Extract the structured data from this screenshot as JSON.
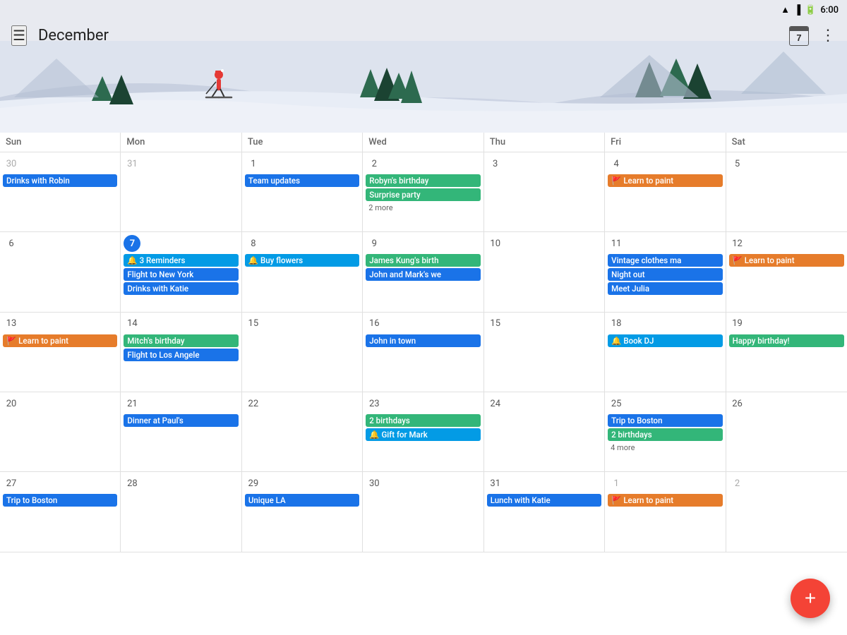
{
  "statusBar": {
    "time": "6:00"
  },
  "header": {
    "menuLabel": "☰",
    "month": "December",
    "calDay": "7",
    "moreLabel": "⋮"
  },
  "dayHeaders": [
    "Sun",
    "Mon",
    "Tue",
    "Wed",
    "Thu",
    "Fri",
    "Sat"
  ],
  "weeks": [
    [
      {
        "num": "30",
        "otherMonth": true,
        "events": [
          {
            "label": "Drinks with Robin",
            "color": "blue"
          }
        ]
      },
      {
        "num": "31",
        "otherMonth": true,
        "events": []
      },
      {
        "num": "1",
        "events": [
          {
            "label": "Team updates",
            "color": "blue"
          }
        ]
      },
      {
        "num": "2",
        "events": [
          {
            "label": "Robyn's birthday",
            "color": "green"
          },
          {
            "label": "Surprise party",
            "color": "green"
          }
        ],
        "more": "2 more"
      },
      {
        "num": "3",
        "events": []
      },
      {
        "num": "4",
        "events": [
          {
            "label": "🚩 Learn to paint",
            "color": "orange"
          }
        ]
      },
      {
        "num": "5",
        "events": []
      }
    ],
    [
      {
        "num": "6",
        "events": []
      },
      {
        "num": "7",
        "today": true,
        "events": [
          {
            "label": "🔔 3 Reminders",
            "color": "cyan"
          },
          {
            "label": "Flight to New York",
            "color": "blue"
          },
          {
            "label": "Drinks with Katie",
            "color": "blue"
          }
        ]
      },
      {
        "num": "8",
        "events": [
          {
            "label": "🔔 Buy flowers",
            "color": "cyan"
          }
        ]
      },
      {
        "num": "9",
        "events": [
          {
            "label": "James Kung's birth",
            "color": "green"
          },
          {
            "label": "John and Mark's we",
            "color": "blue"
          }
        ]
      },
      {
        "num": "10",
        "events": []
      },
      {
        "num": "11",
        "events": [
          {
            "label": "Vintage clothes ma",
            "color": "blue"
          },
          {
            "label": "Night out",
            "color": "blue"
          },
          {
            "label": "Meet Julia",
            "color": "blue"
          }
        ]
      },
      {
        "num": "12",
        "events": [
          {
            "label": "🚩 Learn to paint",
            "color": "orange"
          }
        ]
      }
    ],
    [
      {
        "num": "13",
        "events": [
          {
            "label": "🚩 Learn to paint",
            "color": "orange"
          }
        ]
      },
      {
        "num": "14",
        "events": [
          {
            "label": "Mitch's birthday",
            "color": "green"
          },
          {
            "label": "Flight to Los Angele",
            "color": "blue"
          }
        ]
      },
      {
        "num": "15",
        "events": []
      },
      {
        "num": "16",
        "events": [
          {
            "label": "John in town",
            "color": "blue"
          }
        ]
      },
      {
        "num": "15",
        "events": []
      },
      {
        "num": "18",
        "events": [
          {
            "label": "🔔 Book DJ",
            "color": "cyan"
          }
        ]
      },
      {
        "num": "19",
        "events": [
          {
            "label": "Happy birthday!",
            "color": "green"
          }
        ]
      }
    ],
    [
      {
        "num": "20",
        "events": []
      },
      {
        "num": "21",
        "events": [
          {
            "label": "Dinner at Paul's",
            "color": "blue"
          }
        ]
      },
      {
        "num": "22",
        "events": []
      },
      {
        "num": "23",
        "events": [
          {
            "label": "2 birthdays",
            "color": "green"
          },
          {
            "label": "🔔 Gift for Mark",
            "color": "cyan"
          }
        ]
      },
      {
        "num": "24",
        "events": []
      },
      {
        "num": "25",
        "events": [
          {
            "label": "Trip to Boston",
            "color": "blue"
          },
          {
            "label": "2 birthdays",
            "color": "green"
          }
        ],
        "more": "4 more"
      },
      {
        "num": "26",
        "events": []
      }
    ],
    [
      {
        "num": "27",
        "events": [
          {
            "label": "Trip to Boston",
            "color": "blue"
          }
        ]
      },
      {
        "num": "28",
        "events": []
      },
      {
        "num": "29",
        "events": [
          {
            "label": "Unique LA",
            "color": "blue"
          }
        ]
      },
      {
        "num": "30",
        "events": []
      },
      {
        "num": "31",
        "events": [
          {
            "label": "Lunch with Katie",
            "color": "blue"
          }
        ]
      },
      {
        "num": "1",
        "otherMonth": true,
        "events": [
          {
            "label": "🚩 Learn to paint",
            "color": "orange"
          }
        ]
      },
      {
        "num": "2",
        "otherMonth": true,
        "events": []
      }
    ]
  ],
  "fab": {
    "label": "+"
  }
}
